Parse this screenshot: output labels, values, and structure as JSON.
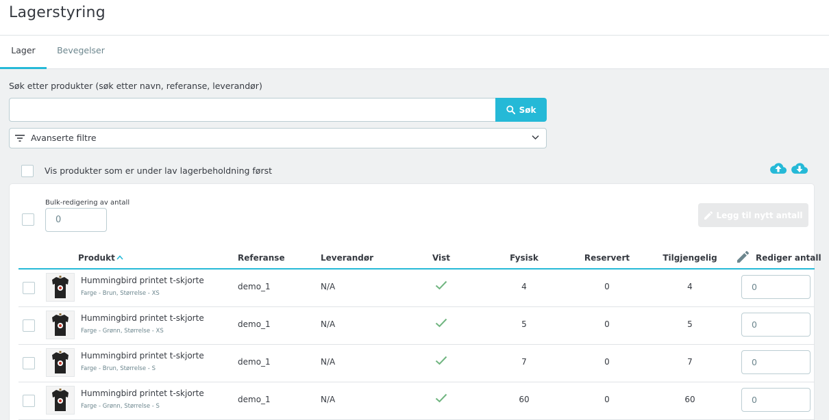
{
  "page": {
    "title": "Lagerstyring"
  },
  "tabs": [
    {
      "label": "Lager",
      "active": true
    },
    {
      "label": "Bevegelser",
      "active": false
    }
  ],
  "search": {
    "label": "Søk etter produkter (søk etter navn, referanse, leverandør)",
    "value": "",
    "button_label": "Søk",
    "button_icon": "search-icon"
  },
  "filters": {
    "label": "Avanserte filtre",
    "icon": "filter-icon"
  },
  "low_stock": {
    "label": "Vis produkter som er under lav lagerbeholdning først",
    "checked": false
  },
  "bulk": {
    "label": "Bulk-redigering av antall",
    "value": "0",
    "add_button_label": "Legg til nytt antall"
  },
  "table": {
    "columns": {
      "product": "Produkt",
      "reference": "Referanse",
      "supplier": "Leverandør",
      "shown": "Vist",
      "physical": "Fysisk",
      "reserved": "Reservert",
      "available": "Tilgjengelig",
      "edit_qty": "Rediger antall"
    },
    "sort": {
      "column": "product",
      "direction": "asc"
    },
    "rows": [
      {
        "name": "Hummingbird printet t-skjorte",
        "attributes": "Farge - Brun, Størrelse - XS",
        "reference": "demo_1",
        "supplier": "N/A",
        "shown": true,
        "physical": "4",
        "reserved": "0",
        "available": "4",
        "edit_qty": "0"
      },
      {
        "name": "Hummingbird printet t-skjorte",
        "attributes": "Farge - Grønn, Størrelse - XS",
        "reference": "demo_1",
        "supplier": "N/A",
        "shown": true,
        "physical": "5",
        "reserved": "0",
        "available": "5",
        "edit_qty": "0"
      },
      {
        "name": "Hummingbird printet t-skjorte",
        "attributes": "Farge - Brun, Størrelse - S",
        "reference": "demo_1",
        "supplier": "N/A",
        "shown": true,
        "physical": "7",
        "reserved": "0",
        "available": "7",
        "edit_qty": "0"
      },
      {
        "name": "Hummingbird printet t-skjorte",
        "attributes": "Farge - Grønn, Størrelse - S",
        "reference": "demo_1",
        "supplier": "N/A",
        "shown": true,
        "physical": "60",
        "reserved": "0",
        "available": "60",
        "edit_qty": "0"
      }
    ]
  },
  "colors": {
    "accent": "#25b9d7",
    "check": "#70b580",
    "text": "#363a41",
    "muted": "#6c868e"
  }
}
